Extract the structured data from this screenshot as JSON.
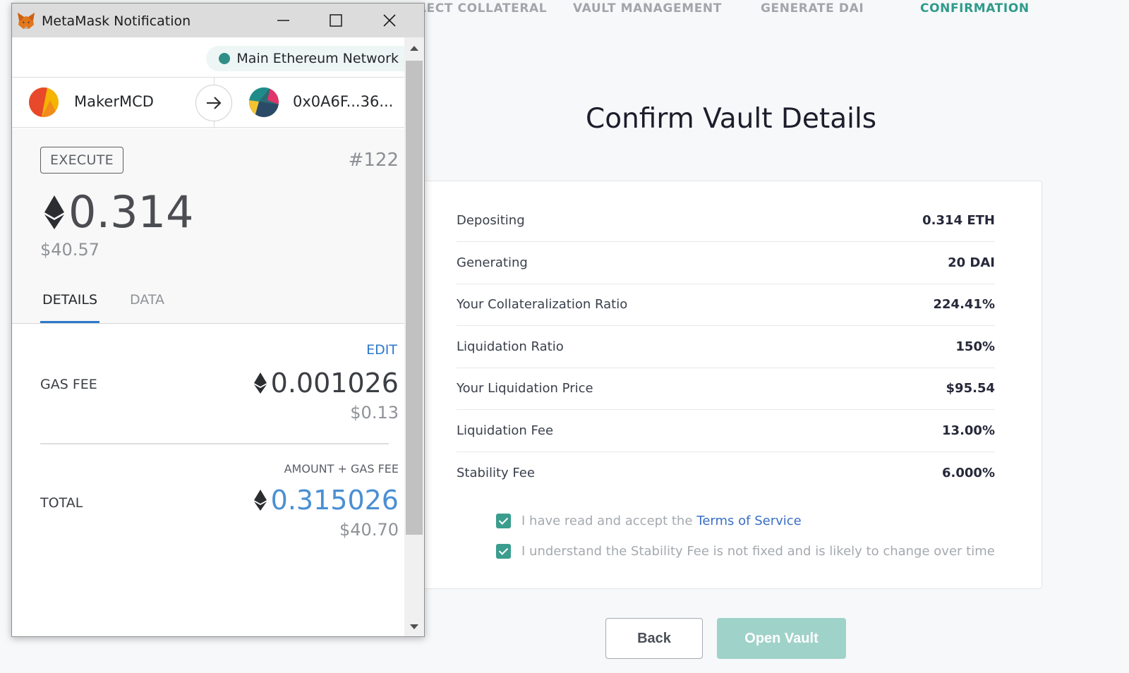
{
  "wizard": {
    "steps": [
      "SELECT COLLATERAL",
      "VAULT MANAGEMENT",
      "GENERATE DAI",
      "CONFIRMATION"
    ],
    "title": "Confirm Vault Details",
    "details": [
      {
        "label": "Depositing",
        "value": "0.314 ETH"
      },
      {
        "label": "Generating",
        "value": "20 DAI"
      },
      {
        "label": "Your Collateralization Ratio",
        "value": "224.41%"
      },
      {
        "label": "Liquidation Ratio",
        "value": "150%"
      },
      {
        "label": "Your Liquidation Price",
        "value": "$95.54"
      },
      {
        "label": "Liquidation Fee",
        "value": "13.00%"
      },
      {
        "label": "Stability Fee",
        "value": "6.000%"
      }
    ],
    "terms_prefix": "I have read and accept the",
    "terms_link": "Terms of Service",
    "stability_ack": "I understand the Stability Fee is not fixed and is likely to change over time",
    "back_label": "Back",
    "open_label": "Open Vault"
  },
  "metamask": {
    "window_title": "MetaMask Notification",
    "network": "Main Ethereum Network",
    "from_account": "MakerMCD",
    "to_account": "0x0A6F...36...",
    "method": "EXECUTE",
    "nonce": "#122",
    "amount": "0.314",
    "amount_fiat": "$40.57",
    "tabs": [
      "DETAILS",
      "DATA"
    ],
    "edit_label": "EDIT",
    "gas_fee_label": "GAS FEE",
    "gas_fee_eth": "0.001026",
    "gas_fee_fiat": "$0.13",
    "total_sub_label": "AMOUNT + GAS FEE",
    "total_label": "TOTAL",
    "total_eth": "0.315026",
    "total_fiat": "$40.70"
  },
  "colors": {
    "accent_teal": "#2f9a8b",
    "open_vault_disabled": "#9fd2c9",
    "metamask_blue": "#2e78c8"
  }
}
